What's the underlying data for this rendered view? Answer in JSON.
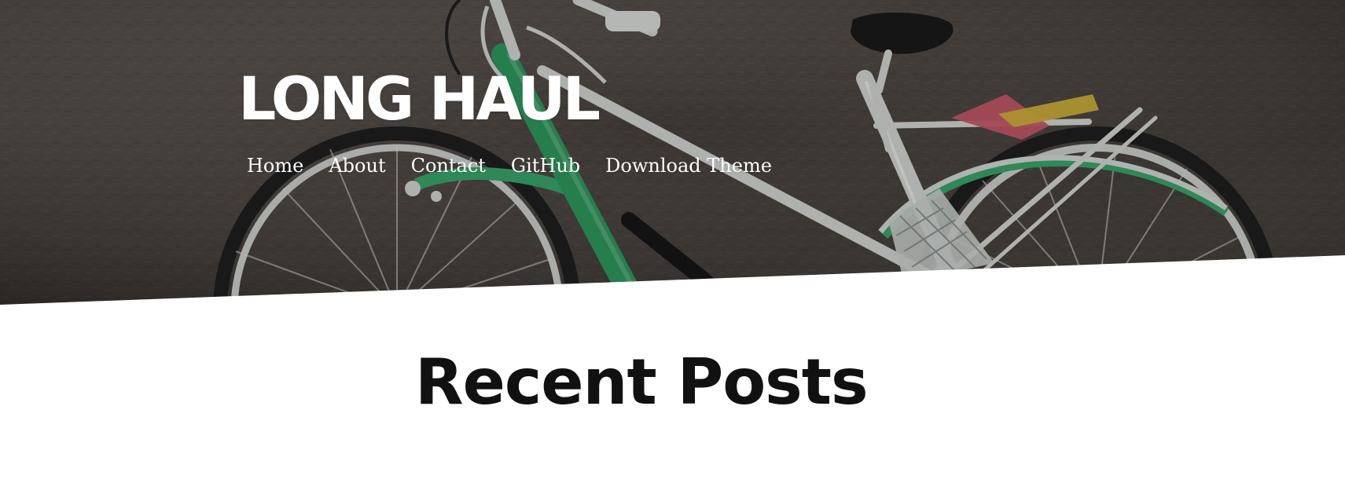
{
  "site": {
    "title": "LONG HAUL"
  },
  "nav": {
    "items": [
      {
        "label": "Home"
      },
      {
        "label": "About"
      },
      {
        "label": "Contact"
      },
      {
        "label": "GitHub"
      },
      {
        "label": "Download Theme"
      }
    ]
  },
  "main": {
    "section_title": "Recent Posts"
  },
  "colors": {
    "hero_dark": "#4a423c",
    "bike_green": "#2f9a5f",
    "bike_white": "#d9ddd8",
    "background": "#ffffff",
    "title_text": "#111111",
    "nav_text": "#ffffff"
  }
}
